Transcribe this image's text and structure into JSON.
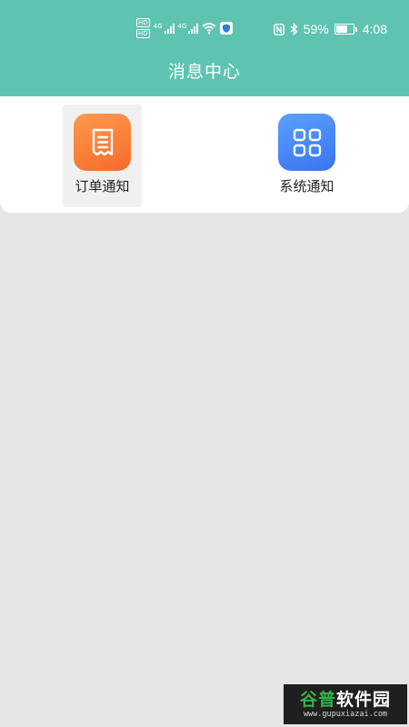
{
  "status_bar": {
    "sim1_label": "HD",
    "sim2_label": "HD",
    "network1_label": "4G",
    "network2_label": "4G",
    "battery_percent": "59%",
    "battery_level": 0.59,
    "time": "4:08",
    "icons": [
      "wifi-icon",
      "shield-icon",
      "nfc-icon",
      "bluetooth-icon",
      "battery-icon"
    ]
  },
  "header": {
    "title": "消息中心",
    "background": "#5ec4b1"
  },
  "menu": {
    "items": [
      {
        "label": "订单通知",
        "icon": "receipt-icon",
        "color": "#f7772f",
        "selected": true
      },
      {
        "label": "系统通知",
        "icon": "grid-apps-icon",
        "color": "#4a86f7",
        "selected": false
      }
    ]
  },
  "watermark": {
    "brand_a": "谷普",
    "brand_b": "软件园",
    "url": "www.gupuxiazai.com"
  }
}
